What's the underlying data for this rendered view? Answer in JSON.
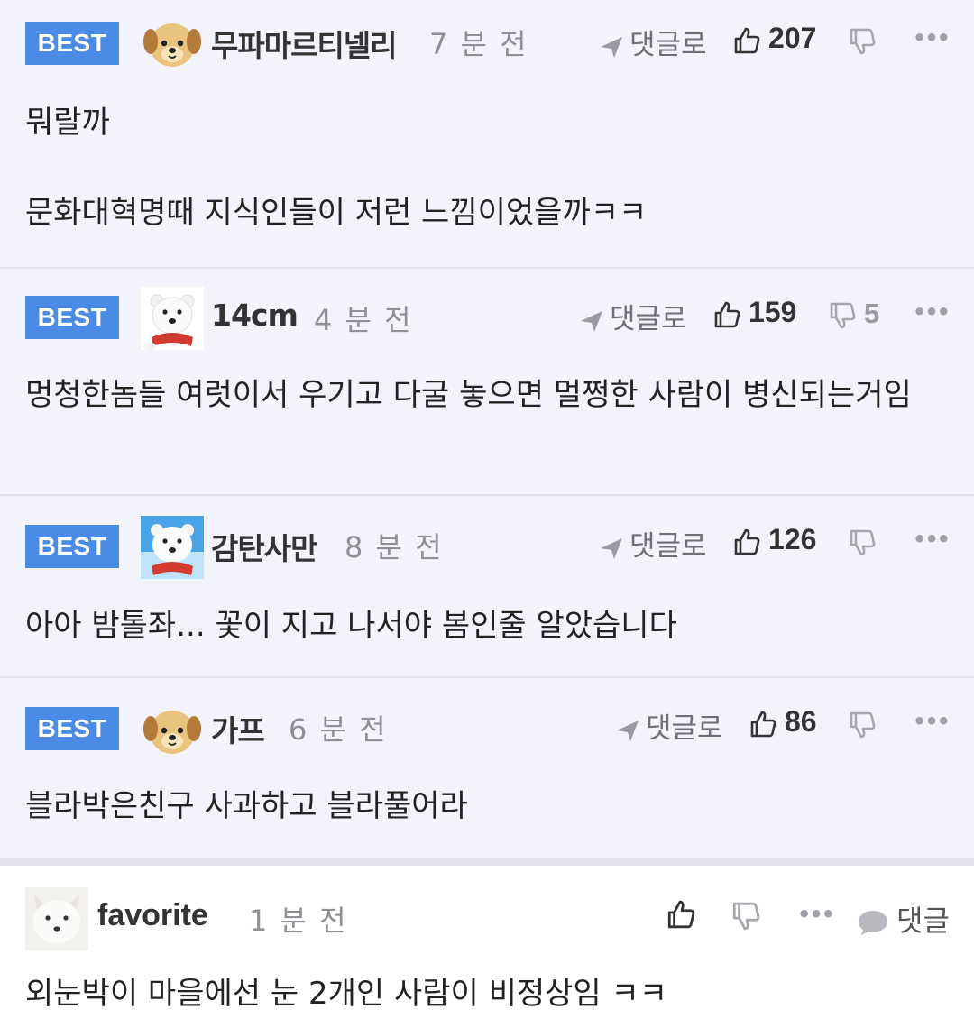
{
  "best_comments": [
    {
      "badge": "BEST",
      "nickname": "무파마르티넬리",
      "time": "7 분 전",
      "reply_label": "댓글로",
      "likes": "207",
      "dislikes": "",
      "body": [
        "뭐랄까",
        "문화대혁명때 지식인들이 저런 느낌이었을까ㅋㅋ"
      ],
      "avatar": "puppy-avatar"
    },
    {
      "badge": "BEST",
      "nickname": "14cm",
      "time": "4 분 전",
      "reply_label": "댓글로",
      "likes": "159",
      "dislikes": "5",
      "body": [
        "멍청한놈들 여럿이서 우기고 다굴 놓으면 멀쩡한 사람이 병신되는거임"
      ],
      "avatar": "polar-bear-avatar"
    },
    {
      "badge": "BEST",
      "nickname": "감탄사만",
      "time": "8 분 전",
      "reply_label": "댓글로",
      "likes": "126",
      "dislikes": "",
      "body": [
        "아아 밤톨좌... 꽃이 지고 나서야 봄인줄 알았습니다"
      ],
      "avatar": "polar-bear-avatar"
    },
    {
      "badge": "BEST",
      "nickname": "가프",
      "time": "6 분 전",
      "reply_label": "댓글로",
      "likes": "86",
      "dislikes": "",
      "body": [
        "블라박은친구 사과하고 블라풀어라"
      ],
      "avatar": "puppy-avatar"
    }
  ],
  "comment": {
    "nickname": "favorite",
    "time": "1 분 전",
    "reply_label": "댓글",
    "body": "외눈박이 마을에선 눈 2개인 사람이 비정상임 ㅋㅋ",
    "avatar": "arctic-fox-avatar"
  },
  "more_label": "•••",
  "colors": {
    "best_badge": "#4a8be6",
    "best_bg": "#f3f4fb",
    "divider": "#e2e3ea"
  }
}
